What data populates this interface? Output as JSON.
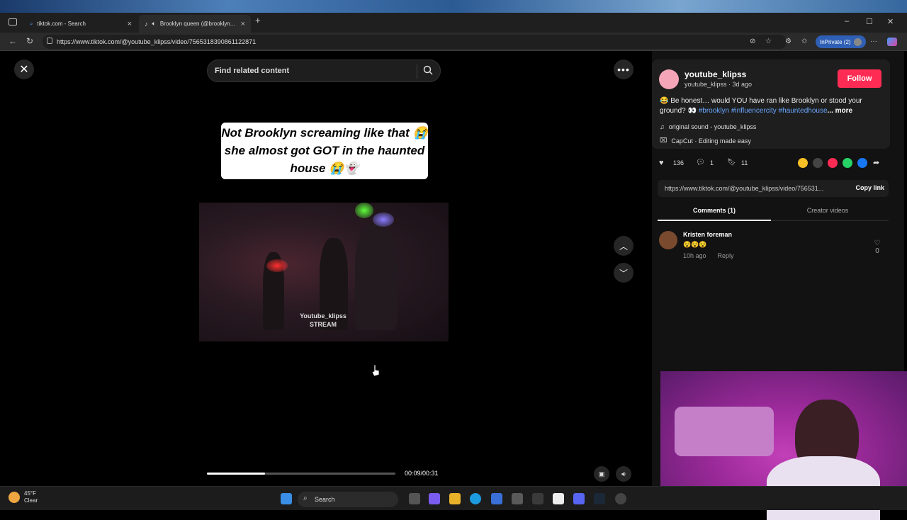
{
  "browser": {
    "tabs": [
      {
        "title": "tiktok.com - Search",
        "icon": "search-icon"
      },
      {
        "title": "Brooklyn queen (@brooklyn...",
        "icon": "tiktok-icon"
      }
    ],
    "url": "https://www.tiktok.com/@youtube_klipss/video/7565318390861122871",
    "inprivate_label": "InPrivate (2)"
  },
  "search": {
    "placeholder": "Find related content"
  },
  "video": {
    "caption": "Not Brooklyn screaming like that 😭 she almost got GOT in the haunted house 😭👻",
    "watermark_line1": "Youtube_klipss",
    "watermark_line2": "STREAM",
    "time": "00:09/00:31",
    "progress": 0.31
  },
  "post": {
    "username": "youtube_klipss",
    "meta": "youtube_klipss · 3d ago",
    "follow_label": "Follow",
    "desc_text": "😂 Be honest… would YOU have ran like Brooklyn or stood your ground? 👀 ",
    "desc_tags": "#brooklyn #influencercity #hauntedhouse",
    "desc_more": "... more",
    "sound": "original sound - youtube_klipss",
    "capcut": "CapCut · Editing made easy",
    "likes": "136",
    "comments_count": "1",
    "saves": "11",
    "share_colors": [
      "#f6c026",
      "#444444",
      "#fe2c55",
      "#25d366",
      "#1877f2"
    ],
    "link": "https://www.tiktok.com/@youtube_klipss/video/756531...",
    "copy_label": "Copy link"
  },
  "tabs": {
    "comments": "Comments (1)",
    "creator": "Creator videos"
  },
  "comment": {
    "name": "Kristen foreman",
    "text": "😵😵😵",
    "time": "10h ago",
    "reply": "Reply",
    "likes": "0"
  },
  "taskbar": {
    "temp": "45°F",
    "condition": "Clear",
    "search_label": "Search"
  }
}
